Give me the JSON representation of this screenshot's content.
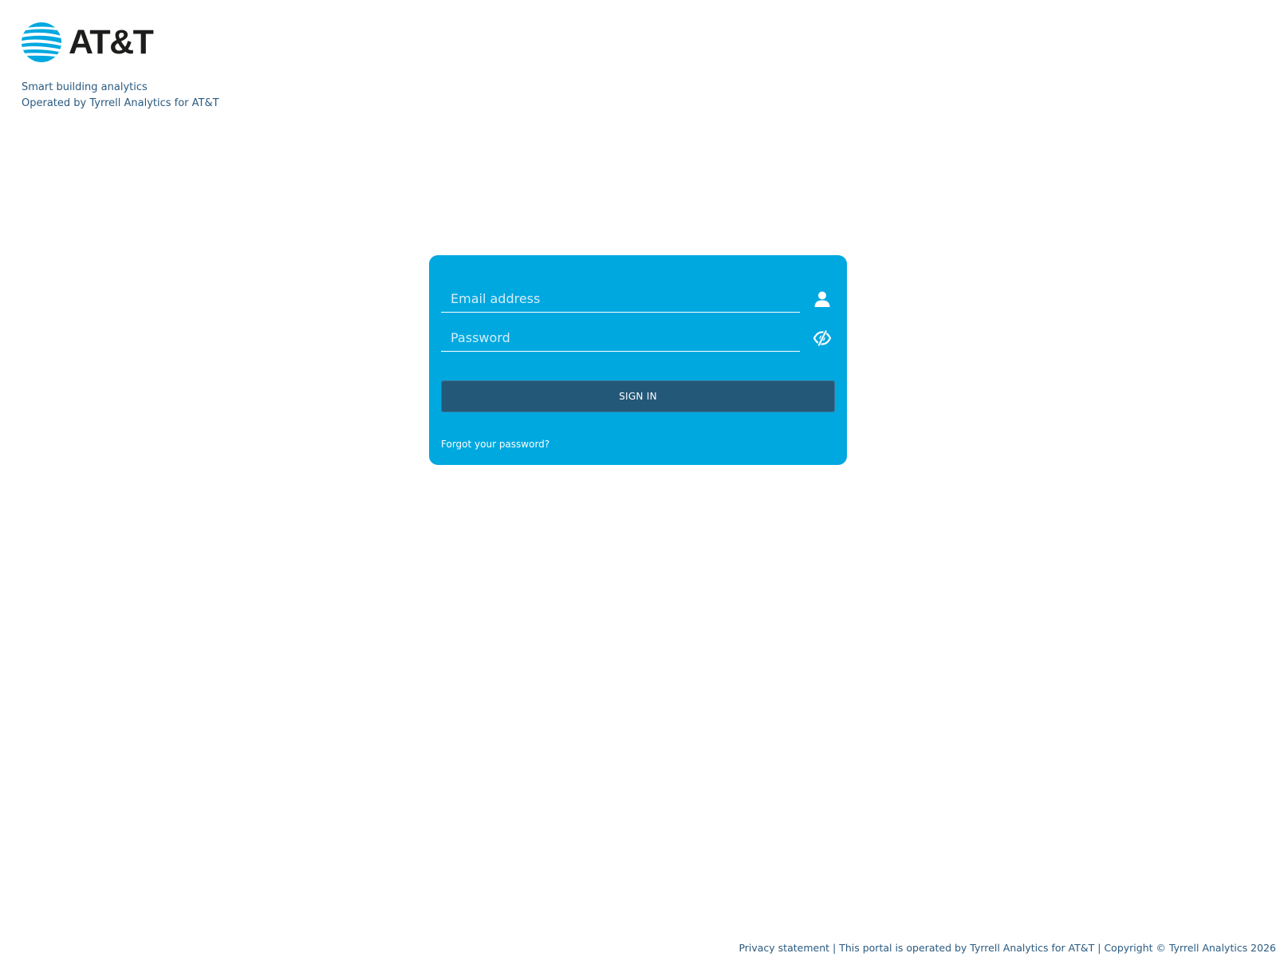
{
  "brand": {
    "name": "AT&T",
    "icon": "att-globe-logo",
    "colors": {
      "globe": "#00a8e0",
      "wordmark": "#1d1d1b"
    }
  },
  "header": {
    "tagline_line1": "Smart building analytics",
    "tagline_line2": "Operated by Tyrrell Analytics for AT&T"
  },
  "login": {
    "email": {
      "placeholder": "Email address",
      "value": "",
      "icon": "user-icon"
    },
    "password": {
      "placeholder": "Password",
      "value": "",
      "icon": "eye-slash-icon"
    },
    "signin_label": "SIGN IN",
    "forgot_label": "Forgot your password?"
  },
  "footer": {
    "privacy_label": "Privacy statement",
    "separator": " | ",
    "operated_text": "This portal is operated by Tyrrell Analytics for AT&T",
    "copyright_text": "Copyright © Tyrrell Analytics 2026"
  },
  "colors": {
    "card_background": "#00a8e0",
    "button_background": "#245878",
    "text_link": "#2a5a80",
    "page_background": "#ffffff"
  }
}
